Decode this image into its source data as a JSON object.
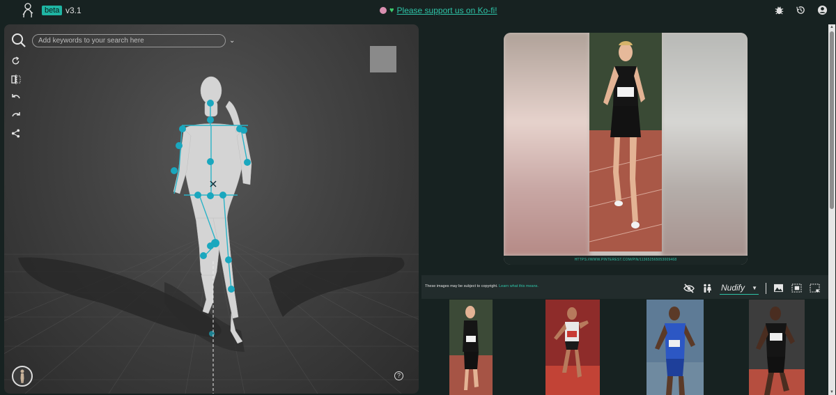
{
  "header": {
    "badge": "beta",
    "version": "v3.1",
    "support_text": "Please support us on Ko-fi!",
    "icons": [
      "logo-icon",
      "bug-icon",
      "history-icon",
      "account-icon"
    ]
  },
  "editor": {
    "search_placeholder": "Add keywords to your search here",
    "tools": [
      "reset-icon",
      "mirror-icon",
      "undo-icon",
      "redo-icon",
      "share-icon"
    ],
    "help_label": "?"
  },
  "results": {
    "source_url": "HTTPS://WWW.PINTEREST.COM/PIN/113652565053009468",
    "copyright_text": "These images may be subject to copyright.",
    "copyright_link": "Learn what this means.",
    "filter_value": "Nudify",
    "accent_color": "#2ec4a8"
  }
}
